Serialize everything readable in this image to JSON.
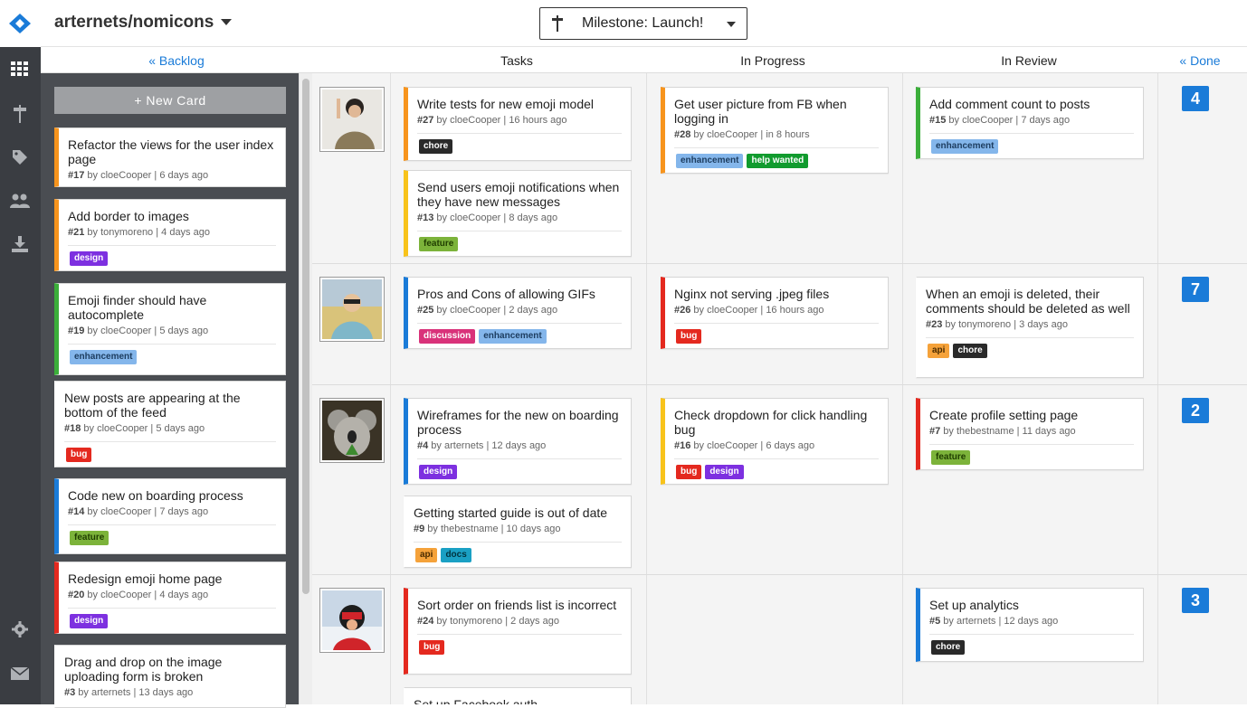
{
  "header": {
    "repo": "arternets/nomicons",
    "milestone": "Milestone: Launch!"
  },
  "columns": {
    "backlog": "« Backlog",
    "tasks": "Tasks",
    "in_progress": "In Progress",
    "in_review": "In Review",
    "done": "« Done"
  },
  "backlog": {
    "new_card": "+ New Card",
    "cards": [
      {
        "title": "Refactor the views for the user index page",
        "num": "#17",
        "meta": " by cloeCooper | 6 days ago",
        "labels": []
      },
      {
        "title": "Add border to images",
        "num": "#21",
        "meta": " by tonymoreno | 4 days ago",
        "labels": [
          "design"
        ]
      },
      {
        "title": "Emoji finder should have autocomplete",
        "num": "#19",
        "meta": " by cloeCooper | 5 days ago",
        "labels": [
          "enhancement"
        ]
      },
      {
        "title": "New posts are appearing at the bottom of the feed",
        "num": "#18",
        "meta": " by cloeCooper | 5 days ago",
        "labels": [
          "bug"
        ]
      },
      {
        "title": "Code new on boarding process",
        "num": "#14",
        "meta": " by cloeCooper | 7 days ago",
        "labels": [
          "feature"
        ]
      },
      {
        "title": "Redesign emoji home page",
        "num": "#20",
        "meta": " by cloeCooper | 4 days ago",
        "labels": [
          "design"
        ]
      },
      {
        "title": "Drag and drop on the image uploading form is broken",
        "num": "#3",
        "meta": " by arternets | 13 days ago",
        "labels": []
      }
    ]
  },
  "rows": [
    {
      "count": "4",
      "tasks": [
        {
          "title": "Write tests for new emoji model",
          "num": "#27",
          "meta": " by cloeCooper | 16 hours ago",
          "labels": [
            "chore"
          ]
        },
        {
          "title": "Send users emoji notifications when they have new messages",
          "num": "#13",
          "meta": " by cloeCooper | 8 days ago",
          "labels": [
            "feature"
          ]
        }
      ],
      "in_progress": [
        {
          "title": "Get user picture from FB when logging in",
          "num": "#28",
          "meta": " by cloeCooper | in 8 hours",
          "labels": [
            "enhancement",
            "help wanted"
          ]
        }
      ],
      "in_review": [
        {
          "title": "Add comment count to posts",
          "num": "#15",
          "meta": " by cloeCooper | 7 days ago",
          "labels": [
            "enhancement"
          ]
        }
      ]
    },
    {
      "count": "7",
      "tasks": [
        {
          "title": "Pros and Cons of allowing GIFs",
          "num": "#25",
          "meta": " by cloeCooper | 2 days ago",
          "labels": [
            "discussion",
            "enhancement"
          ]
        }
      ],
      "in_progress": [
        {
          "title": "Nginx not serving .jpeg files",
          "num": "#26",
          "meta": " by cloeCooper | 16 hours ago",
          "labels": [
            "bug"
          ]
        }
      ],
      "in_review": [
        {
          "title": "When an emoji is deleted, their comments should be deleted as well",
          "num": "#23",
          "meta": " by tonymoreno | 3 days ago",
          "labels": [
            "api",
            "chore"
          ]
        }
      ]
    },
    {
      "count": "2",
      "tasks": [
        {
          "title": "Wireframes for the new on boarding process",
          "num": "#4",
          "meta": " by arternets | 12 days ago",
          "labels": [
            "design"
          ]
        },
        {
          "title": "Getting started guide is out of date",
          "num": "#9",
          "meta": " by thebestname | 10 days ago",
          "labels": [
            "api",
            "docs"
          ]
        }
      ],
      "in_progress": [
        {
          "title": "Check dropdown for click handling bug",
          "num": "#16",
          "meta": " by cloeCooper | 6 days ago",
          "labels": [
            "bug",
            "design"
          ]
        }
      ],
      "in_review": [
        {
          "title": "Create profile setting page",
          "num": "#7",
          "meta": " by thebestname | 11 days ago",
          "labels": [
            "feature"
          ]
        }
      ]
    },
    {
      "count": "3",
      "tasks": [
        {
          "title": "Sort order on friends list is incorrect",
          "num": "#24",
          "meta": " by tonymoreno | 2 days ago",
          "labels": [
            "bug"
          ]
        },
        {
          "title": "Set up Facebook auth",
          "num": "",
          "meta": "",
          "labels": []
        }
      ],
      "in_progress": [],
      "in_review": [
        {
          "title": "Set up analytics",
          "num": "#5",
          "meta": " by arternets | 12 days ago",
          "labels": [
            "chore"
          ]
        }
      ]
    }
  ],
  "icons": [
    "logo-icon",
    "board-grid-icon",
    "signpost-icon",
    "tag-icon",
    "team-icon",
    "download-icon",
    "settings-gear-icon",
    "mail-icon"
  ],
  "colors": {
    "accent": "#1a7bd8",
    "rail": "#3a3d42",
    "backlog": "#4a4d52"
  }
}
